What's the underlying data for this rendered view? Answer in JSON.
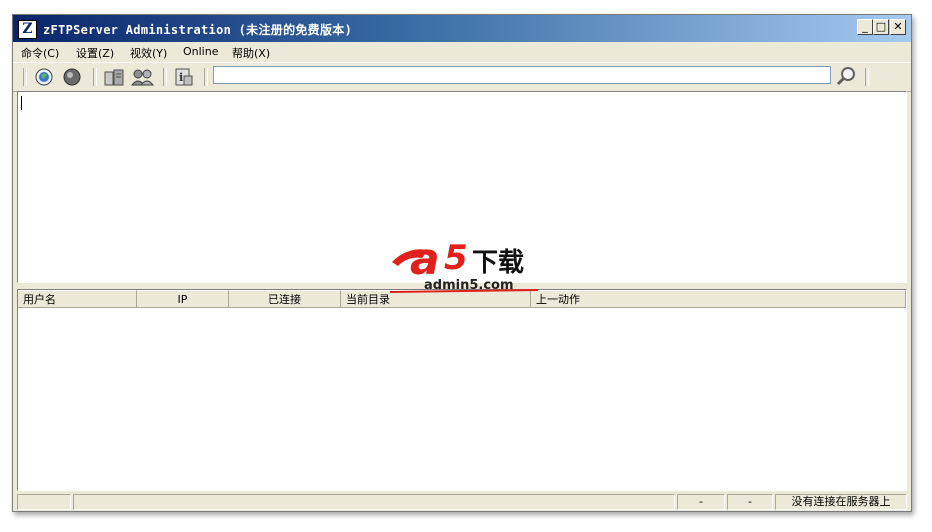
{
  "window": {
    "title": "zFTPServer Administration (未注册的免费版本)",
    "icon_glyph": "Z",
    "controls": {
      "minimize": "_",
      "maximize": "□",
      "close": "✕"
    }
  },
  "menu": {
    "items": [
      {
        "label": "命令(C)"
      },
      {
        "label": "设置(Z)"
      },
      {
        "label": "视效(Y)"
      },
      {
        "label": "Online"
      },
      {
        "label": "帮助(X)"
      }
    ]
  },
  "toolbar": {
    "address_value": "",
    "icons": [
      "connect-globe-icon",
      "disconnect-globe-icon",
      "server-icon",
      "users-icon",
      "info-icon",
      "search-icon"
    ]
  },
  "table": {
    "columns": [
      "用户名",
      "IP",
      "已连接",
      "当前目录",
      "上一动作"
    ],
    "rows": []
  },
  "statusbar": {
    "cells": [
      "",
      "",
      "-",
      "-",
      "没有连接在服务器上"
    ]
  },
  "watermark": {
    "brand_a": "a",
    "brand_5": "5",
    "brand_cn": "下载",
    "domain": "admin5.com"
  },
  "colors": {
    "titlebar_start": "#0a246a",
    "titlebar_end": "#a6caf0",
    "face": "#ece9d8",
    "watermark_red": "#e0201a"
  }
}
